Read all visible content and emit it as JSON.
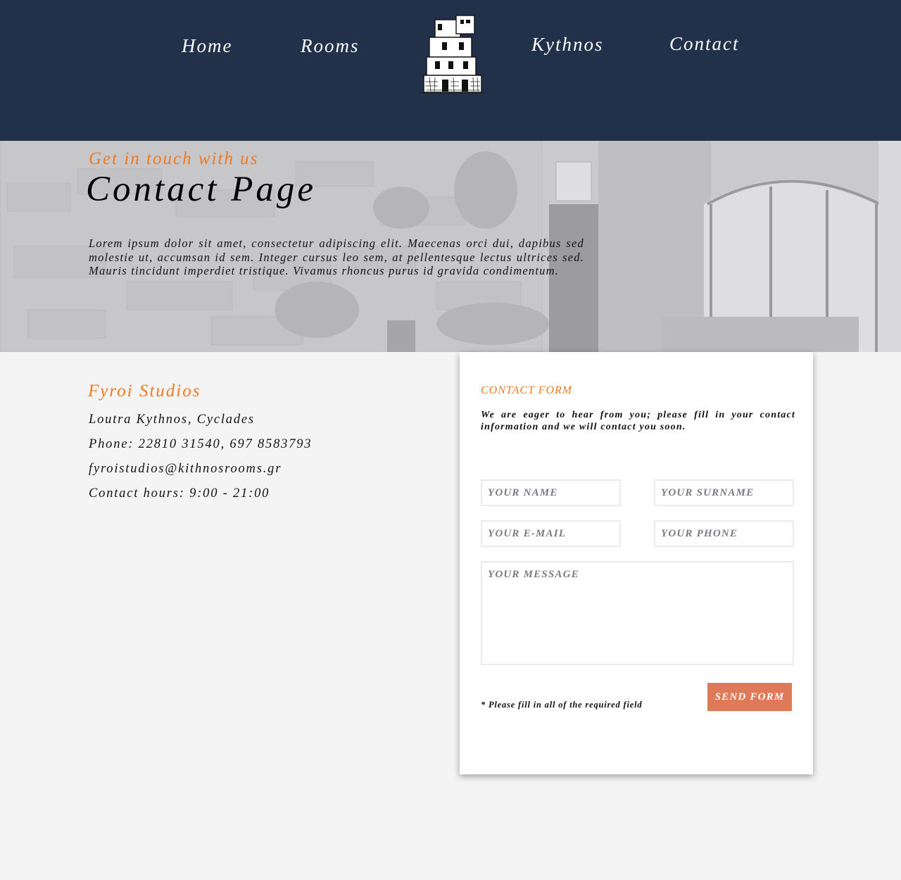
{
  "nav": {
    "home": "Home",
    "rooms": "Rooms",
    "kythnos": "Kythnos",
    "contact": "Contact",
    "background_color": "#22314a"
  },
  "hero": {
    "subtitle": "Get in touch with us",
    "title": "Contact Page",
    "text": "Lorem ipsum dolor sit amet, consectetur adipiscing elit. Maecenas orci dui, dapibus sed molestie ut, accumsan id sem. Integer cursus leo sem, at pellentesque lectus ultrices sed. Mauris tincidunt imperdiet tristique. Vivamus rhoncus purus id gravida condimentum."
  },
  "info": {
    "name": "Fyroi Studios",
    "address": "Loutra Kythnos, Cyclades",
    "phone": "Phone: 22810 31540, 697 8583793",
    "email": "fyroistudios@kithnosrooms.gr",
    "hours": "Contact hours: 9:00 - 21:00"
  },
  "form": {
    "title": "CONTACT FORM",
    "intro": "We are eager to hear from you; please fill in your contact information and we will contact you soon.",
    "name_placeholder": "YOUR NAME",
    "surname_placeholder": "YOUR SURNAME",
    "email_placeholder": "YOUR E-MAIL",
    "phone_placeholder": "YOUR PHONE",
    "message_placeholder": "YOUR MESSAGE",
    "required_note": "* Please fill in all of the required field",
    "submit_label": "SEND FORM"
  },
  "colors": {
    "accent": "#ef7a22",
    "button": "#de7a59",
    "page_background": "#f4f4f4"
  }
}
